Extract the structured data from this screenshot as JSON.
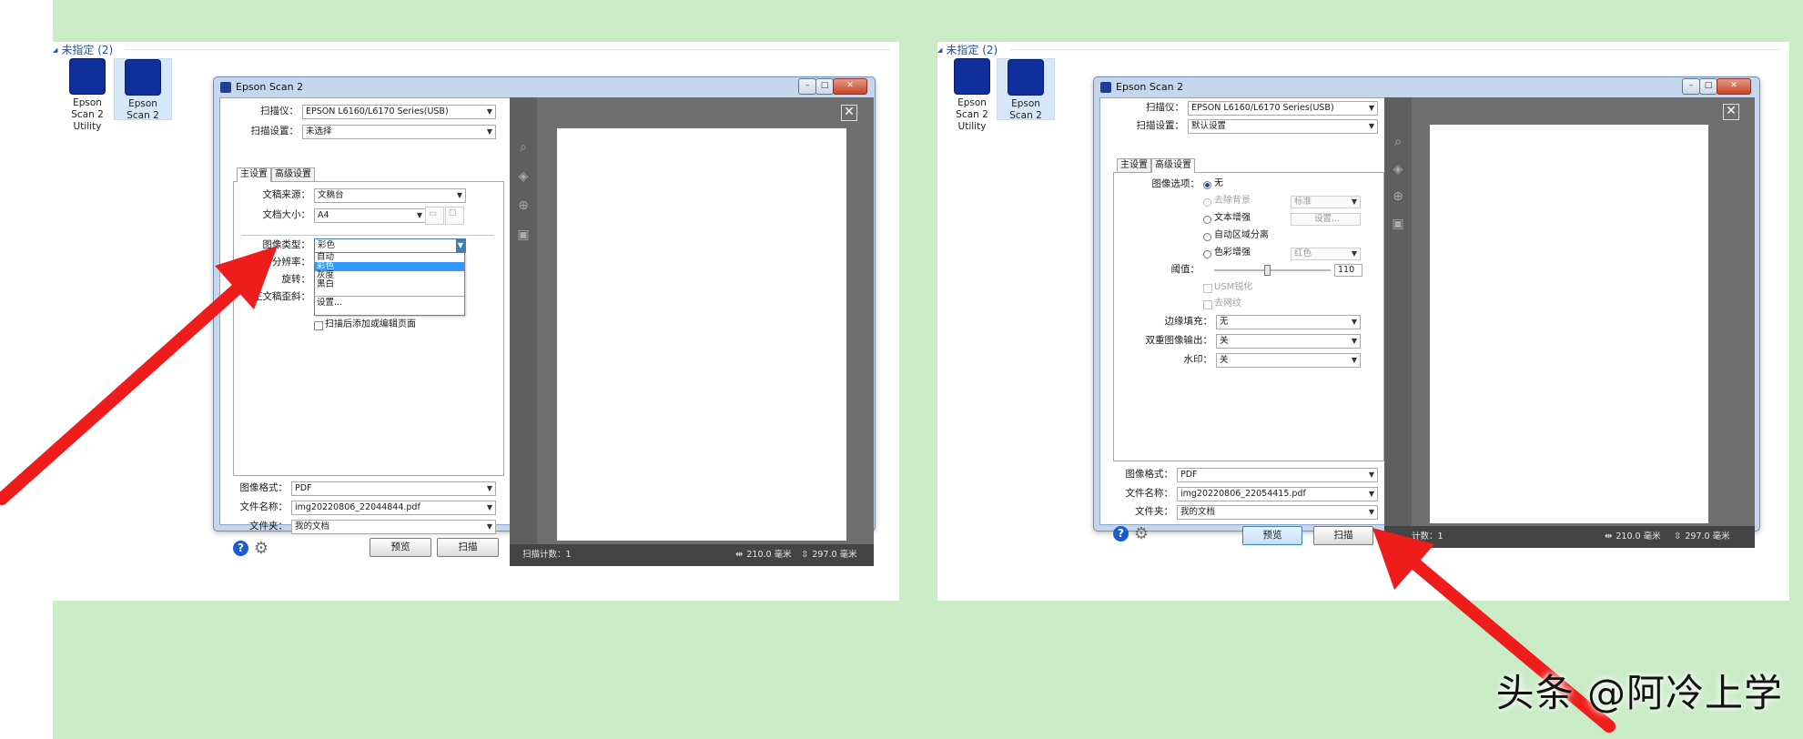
{
  "group_header": "未指定 (2)",
  "desktop_icons": [
    {
      "line1": "Epson",
      "line2": "Scan 2",
      "line3": "Utility"
    },
    {
      "line1": "Epson",
      "line2": "Scan 2"
    }
  ],
  "colors": {
    "accent": "#1f4ea8",
    "arrow": "#ef1c1c",
    "background": "#c9ebc6",
    "preview_bg": "#6f6f6f"
  },
  "window_title": "Epson Scan 2",
  "left": {
    "scanner_label": "扫描仪：",
    "scanner_value": "EPSON L6160/L6170 Series(USB)",
    "settings_label": "扫描设置：",
    "settings_value": "未选择",
    "tab_main": "主设置",
    "tab_adv": "高级设置",
    "doc_source_label": "文稿来源：",
    "doc_source_value": "文稿台",
    "doc_size_label": "文档大小：",
    "doc_size_value": "A4",
    "image_type_label": "图像类型：",
    "image_type_value": "彩色",
    "resolution_label": "分辨率：",
    "rotation_label": "旋转：",
    "skew_label": "校正文稿歪斜：",
    "dropdown_items": [
      "自动",
      "彩色",
      "灰度",
      "黑白"
    ],
    "dropdown_extra": "设置...",
    "add_edit_pages": "扫描后添加或编辑页面",
    "format_label": "图像格式：",
    "format_value": "PDF",
    "filename_label": "文件名称：",
    "filename_value": "img20220806_22044844.pdf",
    "folder_label": "文件夹：",
    "folder_value": "我的文档",
    "preview_btn": "预览",
    "scan_btn": "扫描",
    "scan_count": "扫描计数：1",
    "width": "210.0 毫米",
    "height": "297.0 毫米"
  },
  "right": {
    "scanner_label": "扫描仪：",
    "scanner_value": "EPSON L6160/L6170 Series(USB)",
    "settings_label": "扫描设置：",
    "settings_value": "默认设置",
    "tab_main": "主设置",
    "tab_adv": "高级设置",
    "image_option_label": "图像选项：",
    "opt_none": "无",
    "opt_remove_bg": "去除背景",
    "opt_remove_bg_level": "标准",
    "opt_text_enhance": "文本增强",
    "opt_text_settings": "设置...",
    "opt_auto_area": "自动区域分离",
    "opt_color_enhance": "色彩增强",
    "opt_color_value": "红色",
    "threshold_label": "阈值：",
    "threshold_value": "110",
    "threshold_level": 0.45,
    "usm": "USM锐化",
    "descreen": "去网纹",
    "edge_fill_label": "边缘填充：",
    "edge_fill_value": "无",
    "dual_output_label": "双重图像输出：",
    "dual_output_value": "关",
    "watermark_label": "水印：",
    "watermark_value": "关",
    "format_label": "图像格式：",
    "format_value": "PDF",
    "filename_label": "文件名称：",
    "filename_value": "img20220806_22054415.pdf",
    "folder_label": "文件夹：",
    "folder_value": "我的文档",
    "preview_btn": "预览",
    "scan_btn": "扫描",
    "scan_count": "计数：1",
    "width": "210.0 毫米",
    "height": "297.0 毫米"
  },
  "watermark_text": "头条 @阿冷上学"
}
